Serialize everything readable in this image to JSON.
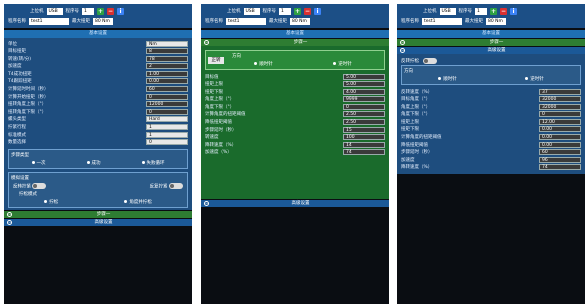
{
  "header": {
    "upper_label": "上位机",
    "upper_value": "USB",
    "prog_no_label": "程序号",
    "prog_no_value": "1",
    "prog_name_label": "程序名称",
    "prog_name_value": "test1",
    "max_torque_label": "最大扭矩",
    "max_torque_value": "80 Nm",
    "plus": "+",
    "minus": "−",
    "info": "i"
  },
  "panel1": {
    "section_title": "基本设置",
    "fields": [
      {
        "label": "单位",
        "value": "Nm"
      },
      {
        "label": "目标扭矩",
        "value": "8"
      },
      {
        "label": "转速(转/分)",
        "value": "78"
      },
      {
        "label": "加速度",
        "value": "2"
      },
      {
        "label": "T4成功扭矩",
        "value": "1.00"
      },
      {
        "label": "T4跟踪扭矩",
        "value": "0.00"
      },
      {
        "label": "计算延时时间（秒）",
        "value": "60"
      },
      {
        "label": "计算开始扭矩（秒）",
        "value": "0"
      },
      {
        "label": "扭转角度上限（°）",
        "value": "12000"
      },
      {
        "label": "扭转角度下限（°）",
        "value": "0"
      },
      {
        "label": "螺头类型",
        "value": "Hard"
      },
      {
        "label": "拧紧行程",
        "value": "1"
      },
      {
        "label": "标准模式",
        "value": "1"
      },
      {
        "label": "数量选择",
        "value": "0"
      }
    ],
    "tab_title": "步骤类型",
    "tab_opts": [
      "一次",
      "成功",
      "失败循环"
    ],
    "switch_title": "模拟设置",
    "switch_a": "反转拧紧",
    "switch_b": "反复拧紧",
    "sub_title": "拧松模式",
    "sub_opts": [
      "拧松",
      "角度并拧松"
    ],
    "step_one": "步骤一",
    "advanced": "高级设置"
  },
  "panel2": {
    "section_title": "基本设置",
    "step_one": "步骤一",
    "dir_tab": "正转",
    "dir_title": "方向",
    "dir_opts": [
      "顺时针",
      "逆时针"
    ],
    "fields": [
      {
        "label": "目标值",
        "value": "5.00"
      },
      {
        "label": "扭矩上限",
        "value": "5.00"
      },
      {
        "label": "扭矩下限",
        "value": "4.00"
      },
      {
        "label": "角度上限（°）",
        "value": "9999"
      },
      {
        "label": "角度下限（°）",
        "value": "0"
      },
      {
        "label": "计算角度的扭矩阈值",
        "value": "2.50"
      },
      {
        "label": "降低扭矩阈值",
        "value": "2.50"
      },
      {
        "label": "步骤延时（秒）",
        "value": "15"
      },
      {
        "label": "转速度",
        "value": "100"
      },
      {
        "label": "降转速度（%）",
        "value": "14"
      },
      {
        "label": "加速度（%）",
        "value": "74"
      }
    ],
    "advanced": "高级设置"
  },
  "panel3": {
    "section_title": "基本设置",
    "step_one": "步骤一",
    "adv_title": "高级设置",
    "reverse_label": "反转拧松",
    "dir_title": "方向",
    "dir_opts": [
      "顺时针",
      "逆时针"
    ],
    "fields": [
      {
        "label": "反转速度（%）",
        "value": "37"
      },
      {
        "label": "目标角度（°）",
        "value": "32000"
      },
      {
        "label": "角度上限（°）",
        "value": "32000"
      },
      {
        "label": "角度下限（°）",
        "value": "0"
      },
      {
        "label": "扭矩上限",
        "value": "12.00"
      },
      {
        "label": "扭矩下限",
        "value": "0.00"
      },
      {
        "label": "计算角度的扭矩阈值",
        "value": "0.00"
      },
      {
        "label": "降低扭矩阈值",
        "value": "0.00"
      },
      {
        "label": "步骤延时（秒）",
        "value": "60"
      },
      {
        "label": "加速度",
        "value": "96"
      },
      {
        "label": "降转速度（%）",
        "value": "74"
      }
    ]
  }
}
